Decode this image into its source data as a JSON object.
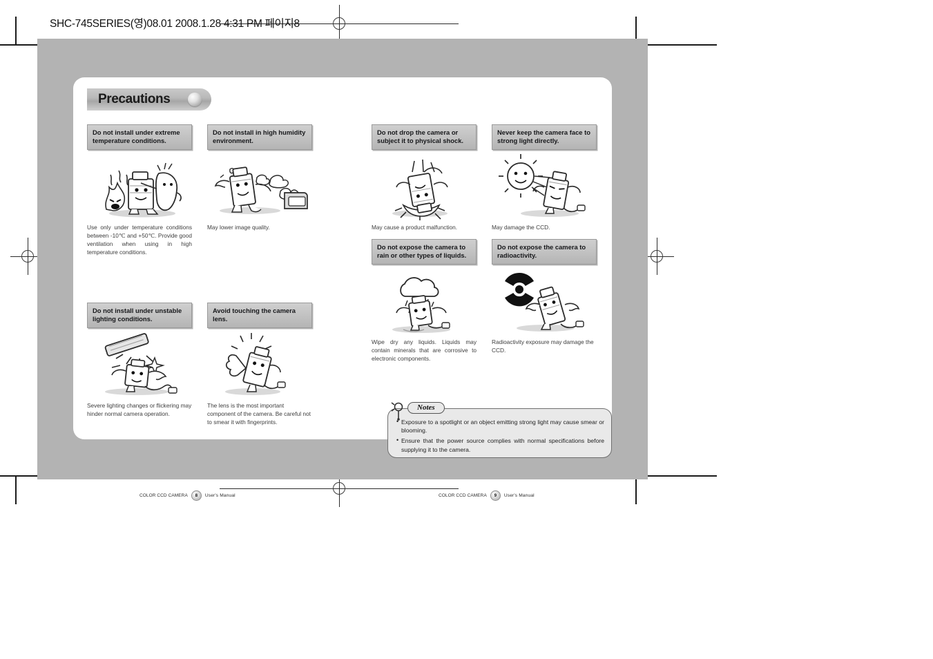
{
  "prepress_header": "SHC-745SERIES(영)08.01  2008.1.28 4:31 PM 페이지8",
  "section": {
    "title": "Precautions"
  },
  "left_page": {
    "items": [
      {
        "heading": "Do not install under extreme temperature conditions.",
        "illustration": "camera-character-with-flames-icon",
        "caption": "Use only under temperature conditions between -10℃ and +50℃. Provide good ventilation when using in high temperature conditions."
      },
      {
        "heading": "Do not install in high humidity environment.",
        "illustration": "camera-character-with-steam-icon",
        "caption": "May lower image quality."
      },
      {
        "heading": "Do not install under unstable lighting conditions.",
        "illustration": "camera-character-with-flickering-light-icon",
        "caption": "Severe lighting changes or flickering may hinder normal camera operation."
      },
      {
        "heading": "Avoid touching the camera lens.",
        "illustration": "camera-character-touching-lens-icon",
        "caption": "The lens is the most important component of the camera. Be careful not to smear it with fingerprints."
      }
    ],
    "footer": {
      "brand": "COLOR CCD CAMERA",
      "page": "8",
      "manual": "User's Manual"
    }
  },
  "right_page": {
    "items": [
      {
        "heading": "Do not drop the camera or subject it to physical shock.",
        "illustration": "camera-character-falling-icon",
        "caption": "May cause a product malfunction."
      },
      {
        "heading": "Never keep the camera face to strong light directly.",
        "illustration": "camera-character-facing-sun-icon",
        "caption": "May damage the CCD."
      },
      {
        "heading": "Do not expose the camera to rain or other types of liquids.",
        "illustration": "camera-character-in-rain-icon",
        "caption": "Wipe dry any liquids. Liquids may contain minerals that are corrosive to electronic components."
      },
      {
        "heading": "Do not expose the camera to radioactivity.",
        "illustration": "camera-character-with-radiation-symbol-icon",
        "caption": "Radioactivity exposure may damage the CCD."
      }
    ],
    "notes": {
      "label": "Notes",
      "items": [
        "Exposure to a spotlight or an object emitting strong light may cause smear or blooming.",
        "Ensure that the power source complies with normal specifications before supplying it to the camera."
      ]
    },
    "footer": {
      "brand": "COLOR CCD CAMERA",
      "page": "9",
      "manual": "User's Manual"
    }
  },
  "colors": {
    "spread_background": "#b3b3b3",
    "sheet": "#ffffff",
    "heading_box": "#c2c2c2",
    "notes_background": "#e9e9e9",
    "text": "#3d3d3d"
  }
}
